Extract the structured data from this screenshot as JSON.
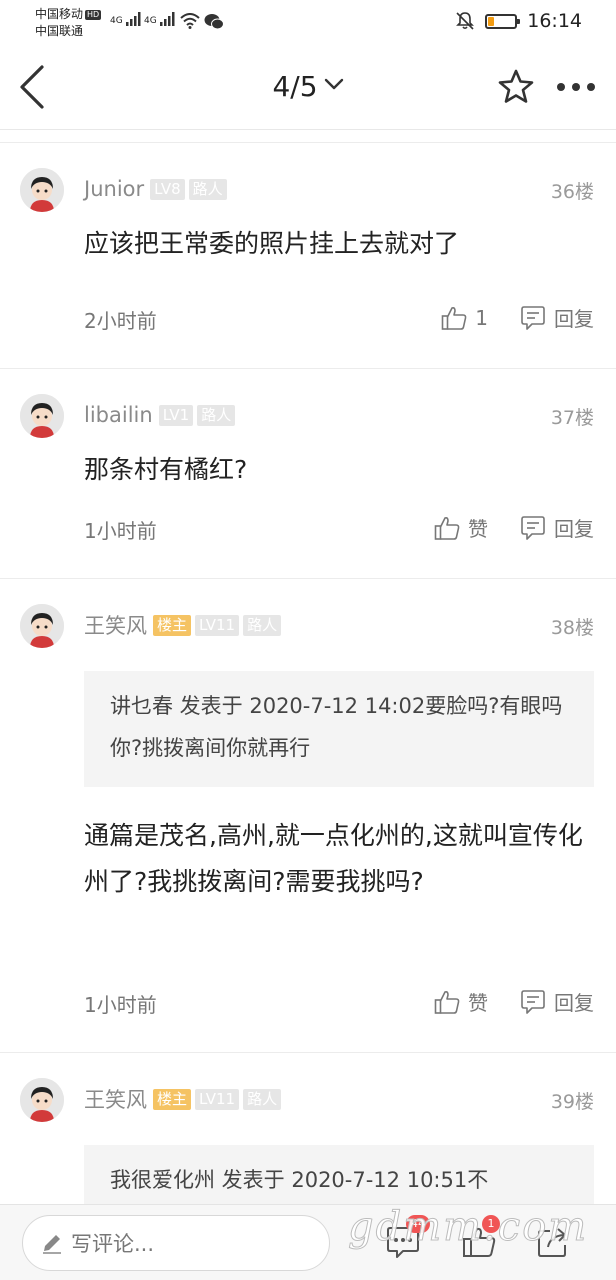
{
  "status_bar": {
    "carrier1": "中国移动",
    "hd": "HD",
    "carrier2": "中国联通",
    "net1": "4G",
    "net2": "4G",
    "time": "16:14",
    "battery_level": 0.2,
    "battery_color": "#f39c12"
  },
  "nav": {
    "pager": "4/5",
    "icons": [
      "back-icon",
      "chevron-down-icon",
      "star-icon",
      "more-icon"
    ]
  },
  "comments": [
    {
      "username": "Junior",
      "tags": [
        "LV8",
        "路人"
      ],
      "floor": "36楼",
      "text": "应该把王常委的照片挂上去就对了",
      "time": "2小时前",
      "like_label": "1",
      "reply_label": "回复"
    },
    {
      "username": "libailin",
      "tags": [
        "LV1",
        "路人"
      ],
      "floor": "37楼",
      "text": "那条村有橘红?",
      "time": "1小时前",
      "like_label": "赞",
      "reply_label": "回复"
    },
    {
      "username": "王笑风",
      "owner_tag": "楼主",
      "tags": [
        "LV11",
        "路人"
      ],
      "floor": "38楼",
      "quote": "讲乜春 发表于 2020-7-12 14:02要脸吗?有眼吗你?挑拨离间你就再行",
      "text": "通篇是茂名,高州,就一点化州的,这就叫宣传化州了?我挑拨离间?需要我挑吗?",
      "time": "1小时前",
      "like_label": "赞",
      "reply_label": "回复"
    },
    {
      "username": "王笑风",
      "owner_tag": "楼主",
      "tags": [
        "LV11",
        "路人"
      ],
      "floor": "39楼",
      "quote": "我很爱化州 发表于 2020-7-12 10:51不"
    }
  ],
  "bottom_bar": {
    "input_placeholder": "写评论...",
    "comment_count": "44",
    "like_count": "1",
    "watermark": "gdmm.com"
  },
  "colors": {
    "owner_tag": "#f5c363",
    "level_tag": "#e6e6e6",
    "badge": "#f05555"
  }
}
